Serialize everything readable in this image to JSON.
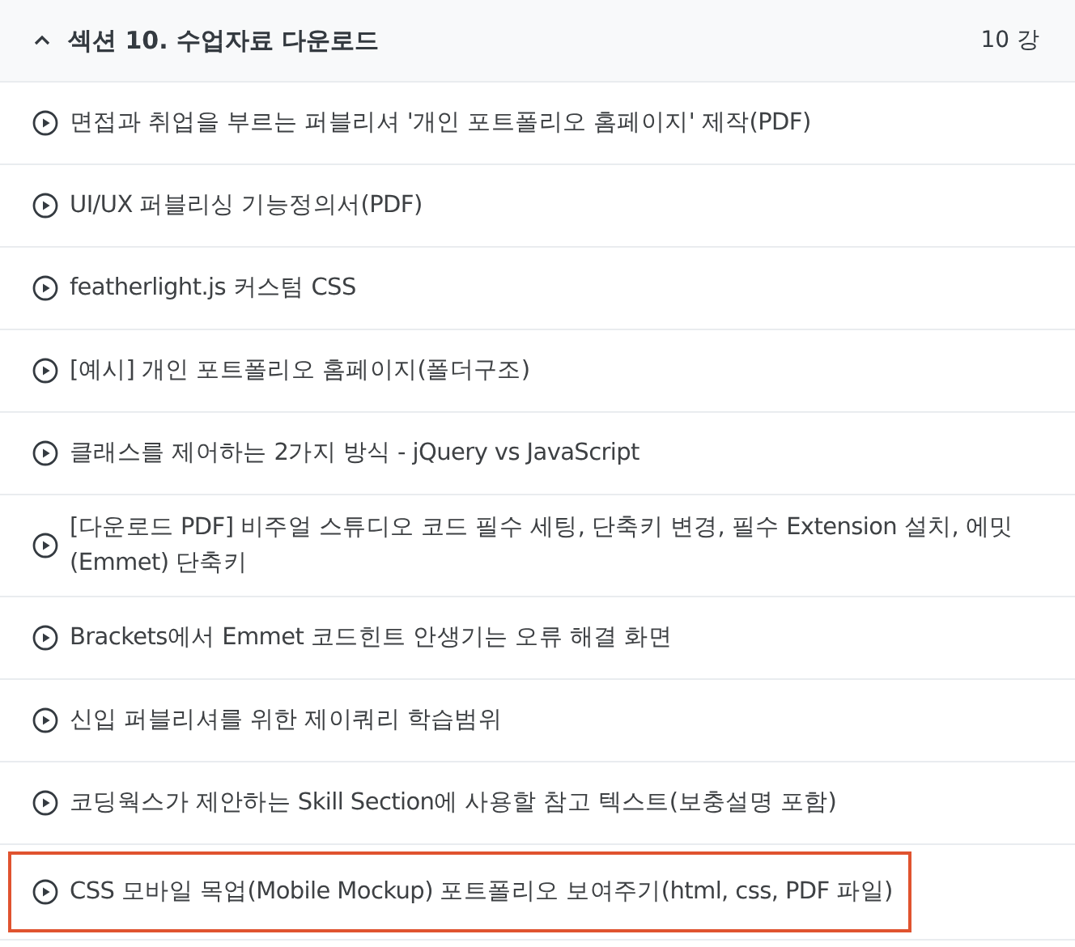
{
  "section": {
    "expanded": true,
    "title": "섹션 10. 수업자료 다운로드",
    "count": "10 강"
  },
  "lessons": [
    {
      "title": "면접과 취업을 부르는 퍼블리셔 '개인 포트폴리오 홈페이지' 제작(PDF)",
      "highlighted": false
    },
    {
      "title": "UI/UX 퍼블리싱 기능정의서(PDF)",
      "highlighted": false
    },
    {
      "title": "featherlight.js 커스텀 CSS",
      "highlighted": false
    },
    {
      "title": "[예시] 개인 포트폴리오 홈페이지(폴더구조)",
      "highlighted": false
    },
    {
      "title": "클래스를 제어하는 2가지 방식 - jQuery vs JavaScript",
      "highlighted": false
    },
    {
      "title": "[다운로드 PDF] 비주얼 스튜디오 코드 필수 세팅, 단축키 변경, 필수 Extension 설치, 에밋(Emmet) 단축키",
      "highlighted": false
    },
    {
      "title": "Brackets에서 Emmet 코드힌트 안생기는 오류 해결 화면",
      "highlighted": false
    },
    {
      "title": "신입 퍼블리셔를 위한 제이쿼리 학습범위",
      "highlighted": false
    },
    {
      "title": "코딩웍스가 제안하는 Skill Section에 사용할 참고 텍스트(보충설명 포함)",
      "highlighted": false
    },
    {
      "title": "CSS 모바일 목업(Mobile Mockup) 포트폴리오 보여주기(html, css, PDF 파일)",
      "highlighted": true
    }
  ]
}
